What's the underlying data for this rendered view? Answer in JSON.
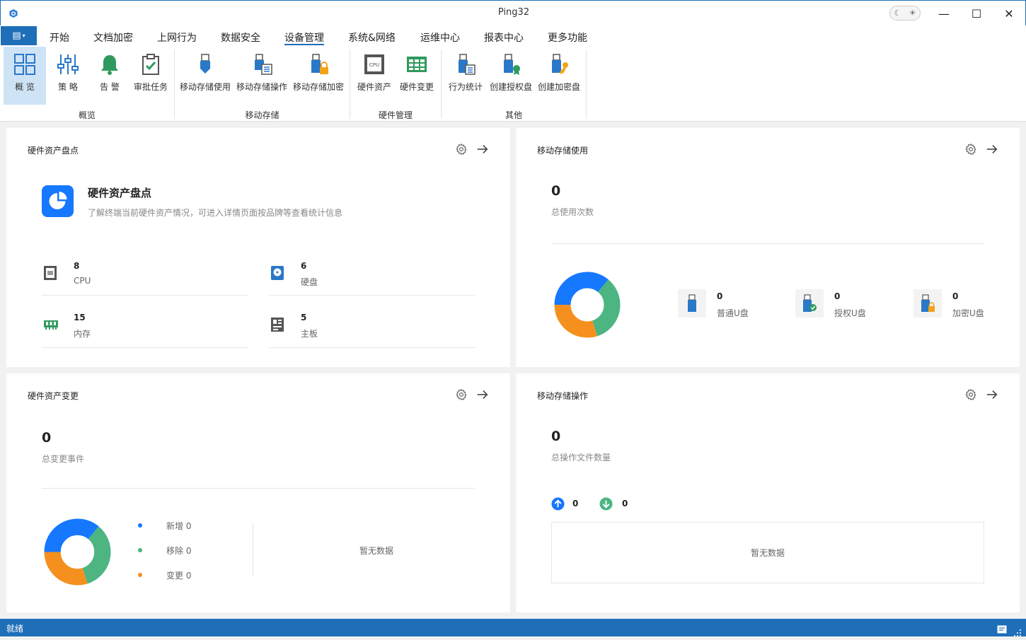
{
  "window": {
    "title": "Ping32",
    "minimize": "—",
    "maximize": "☐",
    "close": "✕",
    "theme_moon": "☾",
    "theme_sun": "☀"
  },
  "menu": {
    "file": "▤",
    "tabs": [
      "开始",
      "文档加密",
      "上网行为",
      "数据安全",
      "设备管理",
      "系统&网络",
      "运维中心",
      "报表中心",
      "更多功能"
    ],
    "active_tab": "设备管理"
  },
  "ribbon": {
    "groups": [
      {
        "label": "概览",
        "buttons": [
          "概 览",
          "策 略",
          "告 警",
          "审批任务"
        ]
      },
      {
        "label": "移动存储",
        "buttons": [
          "移动存储使用",
          "移动存储操作",
          "移动存储加密"
        ]
      },
      {
        "label": "硬件管理",
        "buttons": [
          "硬件资产",
          "硬件变更"
        ]
      },
      {
        "label": "其他",
        "buttons": [
          "行为统计",
          "创建授权盘",
          "创建加密盘"
        ]
      }
    ]
  },
  "hw_inventory": {
    "title": "硬件资产盘点",
    "hero_title": "硬件资产盘点",
    "hero_desc": "了解终端当前硬件资产情况，可进入详情页面按品牌等查看统计信息",
    "items": [
      {
        "value": "8",
        "label": "CPU"
      },
      {
        "value": "6",
        "label": "硬盘"
      },
      {
        "value": "15",
        "label": "内存"
      },
      {
        "value": "5",
        "label": "主板"
      }
    ]
  },
  "usb_usage": {
    "title": "移动存储使用",
    "total": "0",
    "total_label": "总使用次数",
    "donut": [
      {
        "color": "#1677ff",
        "value": 0.36
      },
      {
        "color": "#4cb582",
        "value": 0.34
      },
      {
        "color": "#f5901e",
        "value": 0.3
      }
    ],
    "stats": [
      {
        "value": "0",
        "label": "普通U盘"
      },
      {
        "value": "0",
        "label": "授权U盘"
      },
      {
        "value": "0",
        "label": "加密U盘"
      }
    ]
  },
  "hw_change": {
    "title": "硬件资产变更",
    "total": "0",
    "total_label": "总变更事件",
    "donut": [
      {
        "color": "#1677ff",
        "value": 0.36
      },
      {
        "color": "#4cb582",
        "value": 0.34
      },
      {
        "color": "#f5901e",
        "value": 0.3
      }
    ],
    "legend": [
      {
        "label": "新增 0",
        "color": "#1677ff"
      },
      {
        "label": "移除 0",
        "color": "#4cb582"
      },
      {
        "label": "变更 0",
        "color": "#f5901e"
      }
    ],
    "empty": "暂无数据"
  },
  "usb_ops": {
    "title": "移动存储操作",
    "total": "0",
    "total_label": "总操作文件数量",
    "upload": "0",
    "download": "0",
    "empty": "暂无数据"
  },
  "status": {
    "text": "就绪"
  }
}
